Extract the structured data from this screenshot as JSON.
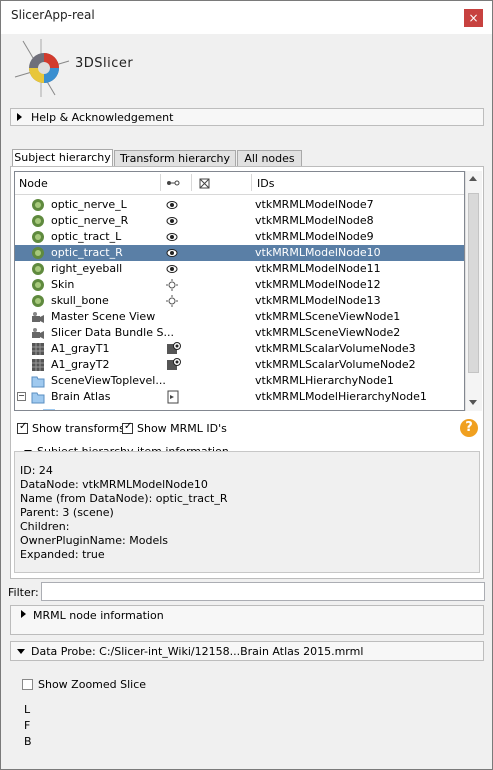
{
  "window": {
    "title": "SlicerApp-real",
    "close_glyph": "×"
  },
  "logo": {
    "text": "3DSlicer"
  },
  "help_section": {
    "label": "Help & Acknowledgement"
  },
  "tabs": [
    {
      "label": "Subject hierarchy",
      "active": true
    },
    {
      "label": "Transform hierarchy",
      "active": false
    },
    {
      "label": "All nodes",
      "active": false
    }
  ],
  "tree": {
    "columns": {
      "node": "Node",
      "ids": "IDs"
    },
    "rows": [
      {
        "name": "optic_nerve_L",
        "id": "vtkMRMLModelNode7",
        "icon": "model-icon",
        "vis": "eye-open",
        "selected": false
      },
      {
        "name": "optic_nerve_R",
        "id": "vtkMRMLModelNode8",
        "icon": "model-icon",
        "vis": "eye-open",
        "selected": false
      },
      {
        "name": "optic_tract_L",
        "id": "vtkMRMLModelNode9",
        "icon": "model-icon",
        "vis": "eye-open",
        "selected": false
      },
      {
        "name": "optic_tract_R",
        "id": "vtkMRMLModelNode10",
        "icon": "model-icon",
        "vis": "eye-open",
        "selected": true
      },
      {
        "name": "right_eyeball",
        "id": "vtkMRMLModelNode11",
        "icon": "model-icon",
        "vis": "eye-open",
        "selected": false
      },
      {
        "name": "Skin",
        "id": "vtkMRMLModelNode12",
        "icon": "model-icon",
        "vis": "eye-closed",
        "selected": false
      },
      {
        "name": "skull_bone",
        "id": "vtkMRMLModelNode13",
        "icon": "model-icon",
        "vis": "eye-closed",
        "selected": false
      },
      {
        "name": "Master Scene View",
        "id": "vtkMRMLSceneViewNode1",
        "icon": "sceneview-icon",
        "vis": "",
        "selected": false
      },
      {
        "name": "Slicer Data Bundle S...",
        "id": "vtkMRMLSceneViewNode2",
        "icon": "sceneview-icon",
        "vis": "",
        "selected": false
      },
      {
        "name": "A1_grayT1",
        "id": "vtkMRMLScalarVolumeNode3",
        "icon": "volume-icon",
        "vis": "volume",
        "selected": false
      },
      {
        "name": "A1_grayT2",
        "id": "vtkMRMLScalarVolumeNode2",
        "icon": "volume-icon",
        "vis": "volume",
        "selected": false
      },
      {
        "name": "SceneViewToplevel...",
        "id": "vtkMRMLHierarchyNode1",
        "icon": "folder-icon",
        "vis": "",
        "selected": false
      },
      {
        "name": "Brain Atlas",
        "id": "vtkMRMLModelHierarchyNode1",
        "icon": "folder-icon",
        "vis": "transform",
        "selected": false
      }
    ]
  },
  "options": {
    "show_transforms": "Show transforms",
    "show_mrml_ids": "Show MRML ID's"
  },
  "info": {
    "title": "Subject hierarchy item information",
    "lines": [
      "ID: 24",
      "DataNode: vtkMRMLModelNode10",
      "Name (from DataNode): optic_tract_R",
      "Parent: 3 (scene)",
      "Children:",
      "OwnerPluginName: Models",
      "Expanded: true"
    ]
  },
  "filter": {
    "label": "Filter:",
    "value": ""
  },
  "mrml_info": {
    "label": "MRML node information"
  },
  "data_probe": {
    "label": "Data Probe: C:/Slicer-int_Wiki/12158...Brain Atlas 2015.mrml",
    "show_zoomed": "Show Zoomed Slice",
    "lines": [
      "L",
      "F",
      "B"
    ]
  }
}
